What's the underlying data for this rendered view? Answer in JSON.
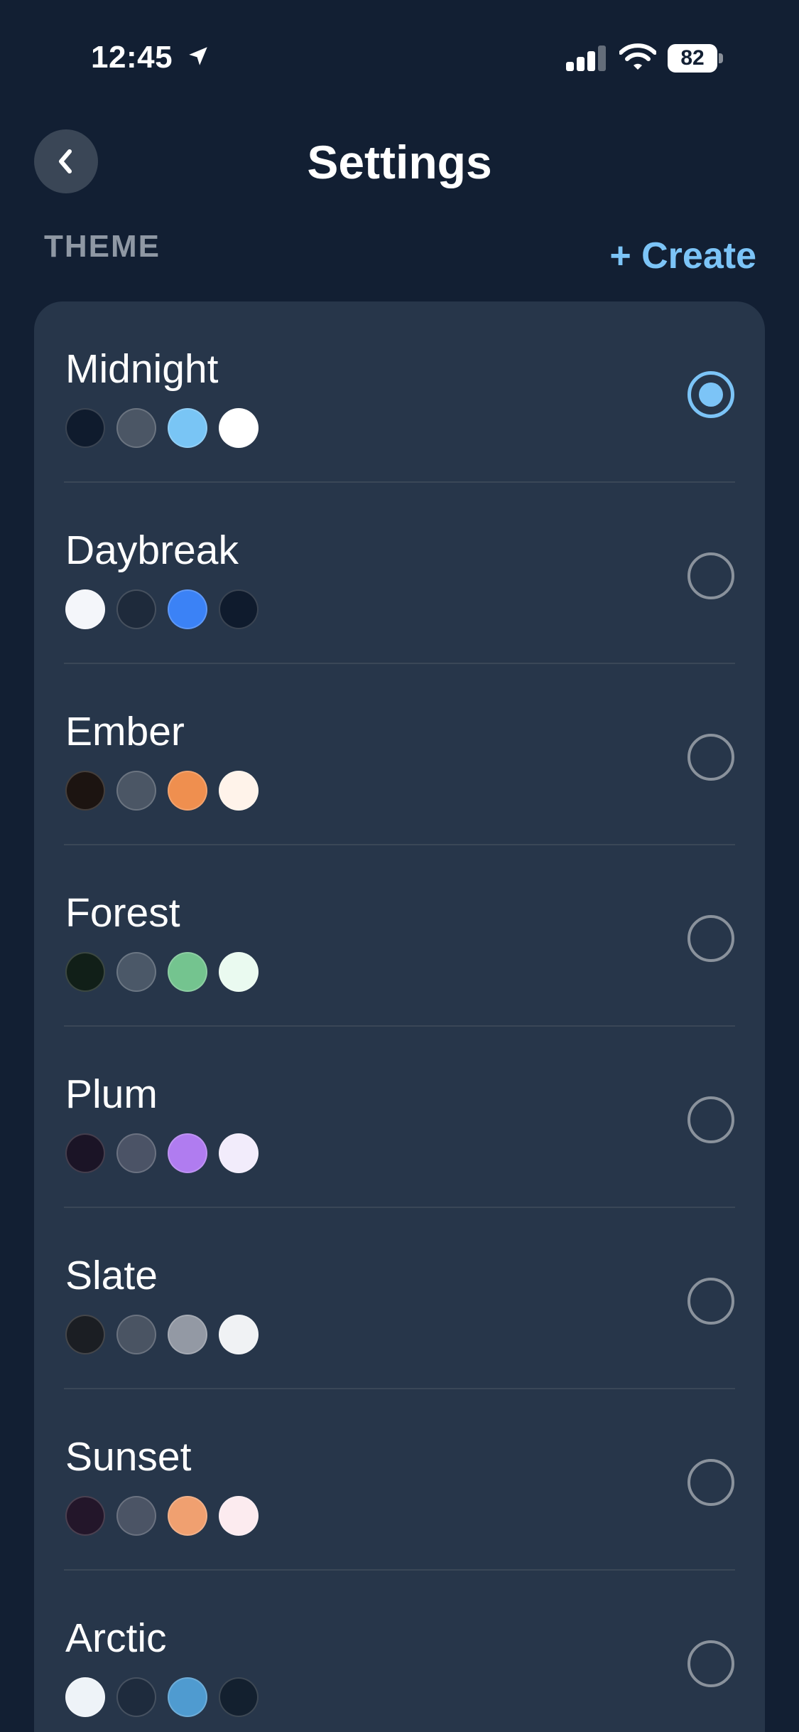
{
  "status_bar": {
    "time": "12:45",
    "battery": "82",
    "icons": [
      "location-arrow-icon",
      "cellular-signal-icon",
      "wifi-icon",
      "battery-icon"
    ]
  },
  "header": {
    "title": "Settings",
    "back_icon": "chevron-left-icon"
  },
  "section": {
    "label": "THEME",
    "create_label": "+ Create"
  },
  "colors": {
    "background": "#121f33",
    "card": "#27364a",
    "accent": "#7cc4f7",
    "muted_text": "#8f98a4"
  },
  "themes": [
    {
      "name": "Midnight",
      "selected": true,
      "swatches": [
        "#0f1b2d",
        "#4b5665",
        "#79c5f5",
        "#ffffff"
      ]
    },
    {
      "name": "Daybreak",
      "selected": false,
      "swatches": [
        "#f4f6fa",
        "#1e2a3b",
        "#3b82f6",
        "#0f1b2d"
      ]
    },
    {
      "name": "Ember",
      "selected": false,
      "swatches": [
        "#1c1411",
        "#4b5665",
        "#ef8f4f",
        "#fff3ea"
      ]
    },
    {
      "name": "Forest",
      "selected": false,
      "swatches": [
        "#111f18",
        "#4b5868",
        "#74c48f",
        "#eafaf0"
      ]
    },
    {
      "name": "Plum",
      "selected": false,
      "swatches": [
        "#1b1426",
        "#4b5366",
        "#b07cf0",
        "#f2ecfb"
      ]
    },
    {
      "name": "Slate",
      "selected": false,
      "swatches": [
        "#1b1e23",
        "#4a5463",
        "#9399a4",
        "#f0f2f4"
      ]
    },
    {
      "name": "Sunset",
      "selected": false,
      "swatches": [
        "#23162a",
        "#4b5465",
        "#f0a070",
        "#fcebef"
      ]
    },
    {
      "name": "Arctic",
      "selected": false,
      "swatches": [
        "#eef3f8",
        "#1e2b3d",
        "#4f9bd0",
        "#13202f"
      ]
    }
  ]
}
